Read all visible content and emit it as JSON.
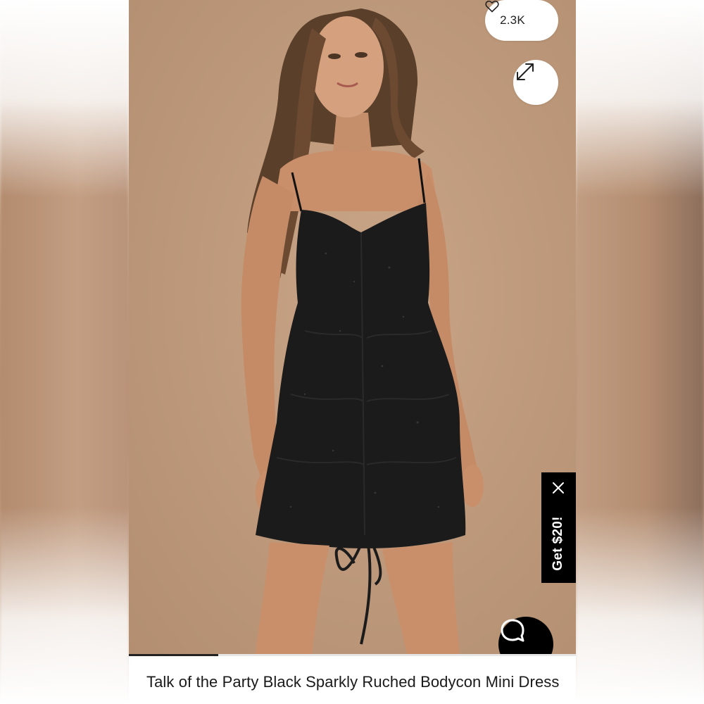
{
  "listing": {
    "likes_count": "2.3K",
    "title": "Talk of the Party Black Sparkly Ruched Bodycon Mini Dress",
    "image_progress_fraction": 0.2
  },
  "promo": {
    "label": "Get $20!"
  },
  "icons": {
    "like": "heart-outline-icon",
    "expand": "expand-arrows-icon",
    "promo_close": "close-icon",
    "chat": "chat-bubble-icon"
  },
  "colors": {
    "photo_background": "#c19c7e",
    "dress": "#1b1b1b",
    "promo_background": "#000000",
    "chat_background": "#000000",
    "pill_background": "#ffffff"
  }
}
